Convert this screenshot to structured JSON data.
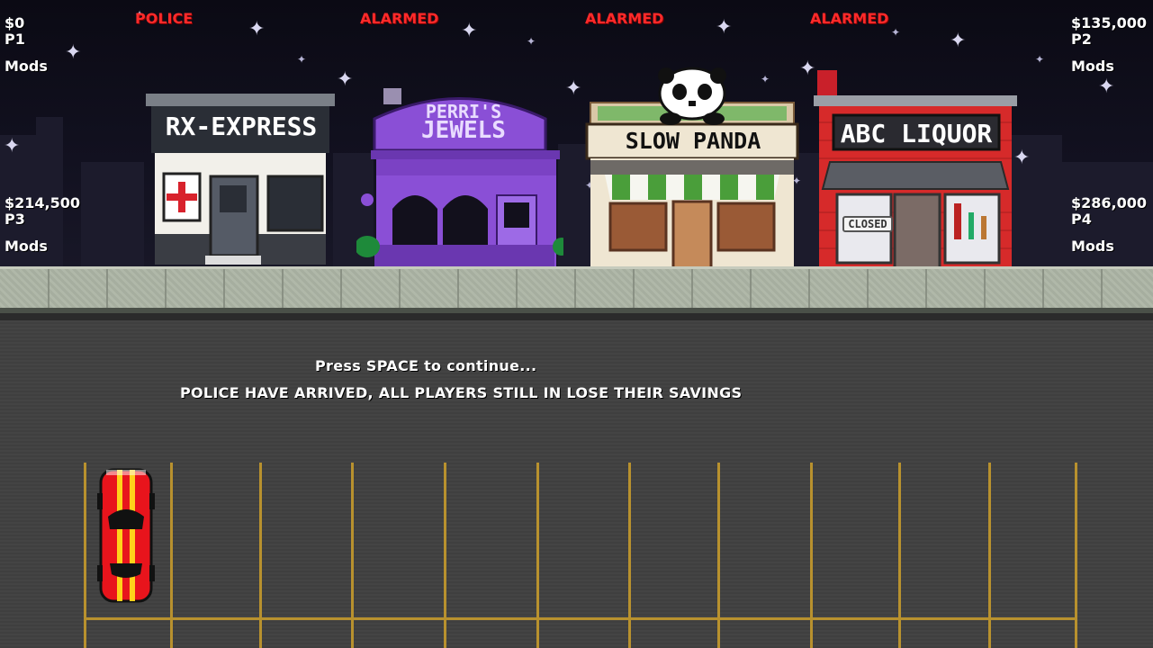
{
  "players": {
    "p1": {
      "money": "$0",
      "label": "P1",
      "mods": "Mods"
    },
    "p2": {
      "money": "$135,000",
      "label": "P2",
      "mods": "Mods"
    },
    "p3": {
      "money": "$214,500",
      "label": "P3",
      "mods": "Mods"
    },
    "p4": {
      "money": "$286,000",
      "label": "P4",
      "mods": "Mods"
    }
  },
  "store_status": [
    "POLICE",
    "ALARMED",
    "ALARMED",
    "ALARMED"
  ],
  "stores": [
    {
      "name": "RX-EXPRESS"
    },
    {
      "name_line1": "PERRI'S",
      "name_line2": "JEWELS"
    },
    {
      "name": "SLOW PANDA"
    },
    {
      "name": "ABC LIQUOR",
      "window_sign": "CLOSED"
    }
  ],
  "messages": {
    "prompt": "Press SPACE to continue...",
    "event": "POLICE HAVE ARRIVED, ALL PLAYERS STILL IN LOSE THEIR SAVINGS"
  },
  "colors": {
    "status_red": "#ff2a2a",
    "car_red": "#e8141c",
    "car_stripe": "#ffd21a",
    "parking_line": "#b8912e"
  }
}
